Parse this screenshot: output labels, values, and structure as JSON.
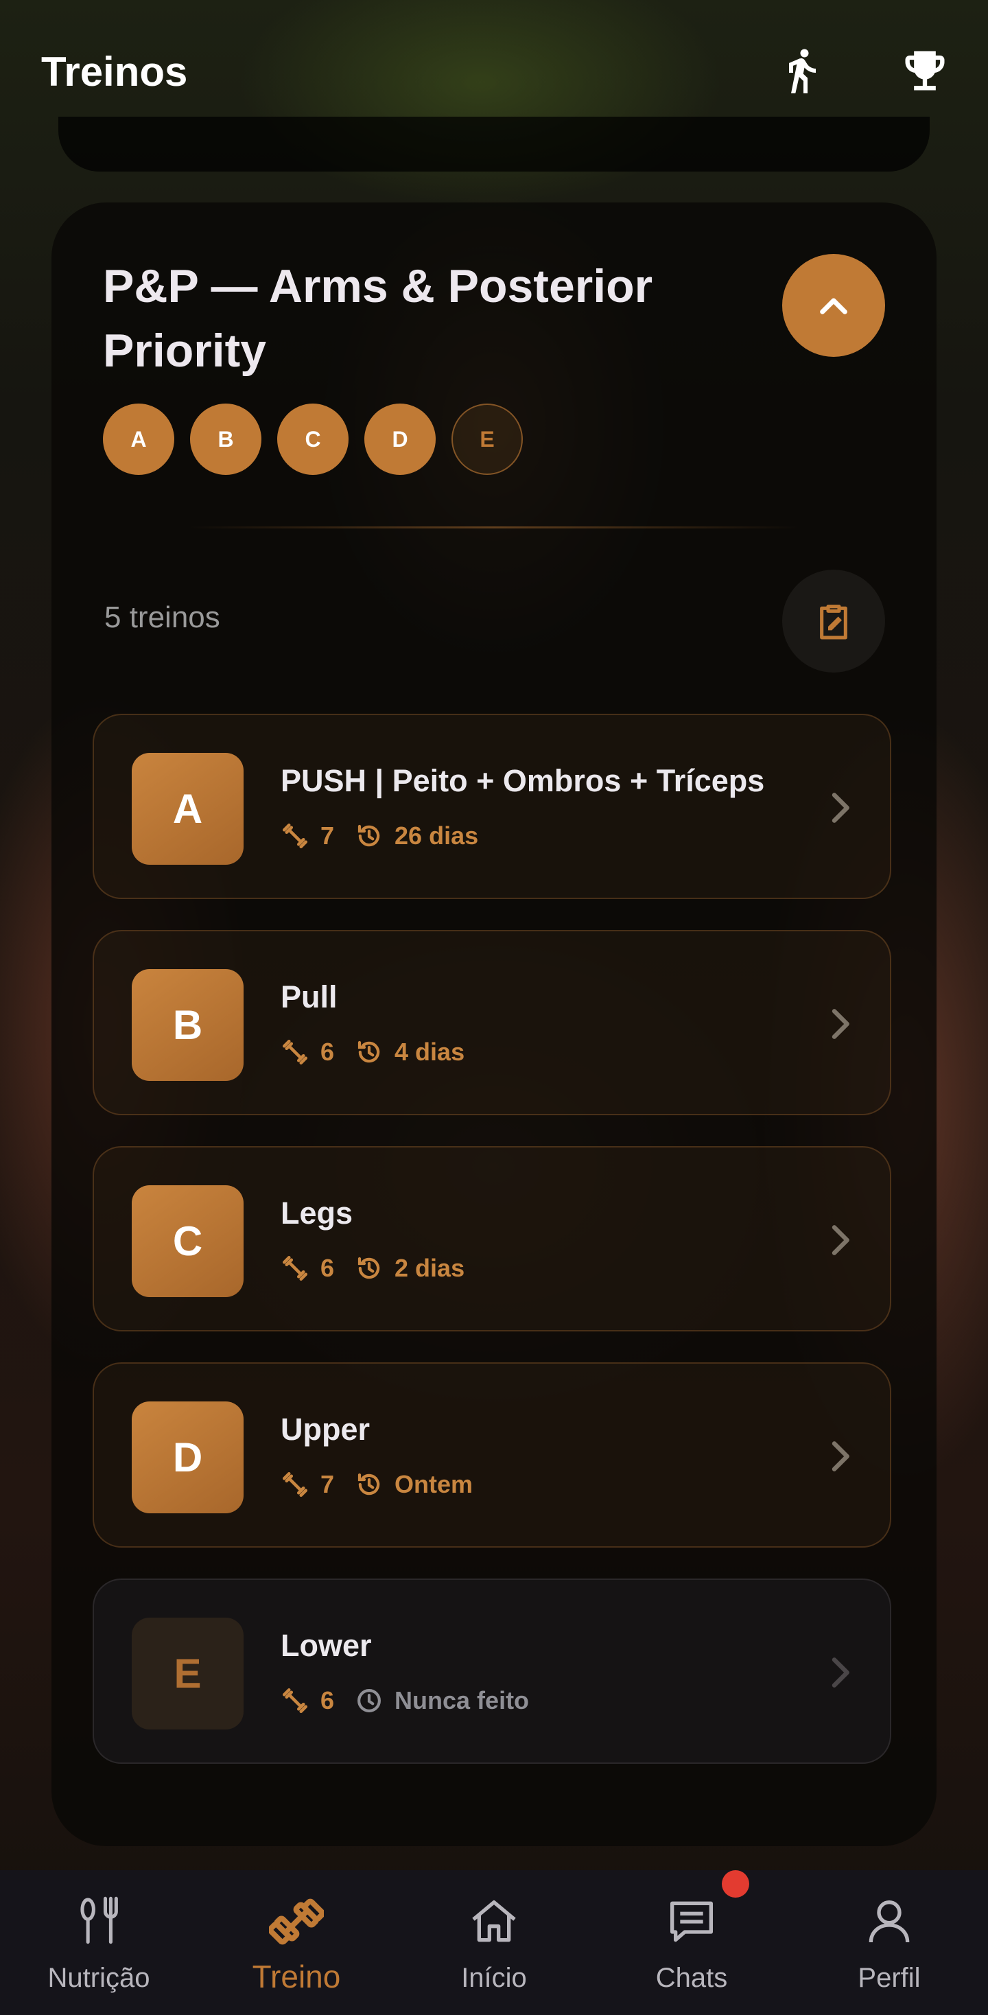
{
  "header": {
    "title": "Treinos",
    "run_icon": "running-icon",
    "trophy_icon": "trophy-icon"
  },
  "plan": {
    "title": "P&P — Arms & Posterior Priority",
    "chips": [
      "A",
      "B",
      "C",
      "D",
      "E"
    ],
    "count_label": "5 treinos"
  },
  "workouts": [
    {
      "letter": "A",
      "name": "PUSH | Peito + Ombros + Tríceps",
      "exercises": "7",
      "last": "26 dias",
      "done": true
    },
    {
      "letter": "B",
      "name": "Pull",
      "exercises": "6",
      "last": "4 dias",
      "done": true
    },
    {
      "letter": "C",
      "name": "Legs",
      "exercises": "6",
      "last": "2 dias",
      "done": true
    },
    {
      "letter": "D",
      "name": "Upper",
      "exercises": "7",
      "last": "Ontem",
      "done": true
    },
    {
      "letter": "E",
      "name": "Lower",
      "exercises": "6",
      "last": "Nunca feito",
      "done": false
    }
  ],
  "nav": [
    {
      "label": "Nutrição",
      "icon": "utensils-icon"
    },
    {
      "label": "Treino",
      "icon": "dumbbell-icon",
      "active": true
    },
    {
      "label": "Início",
      "icon": "home-icon"
    },
    {
      "label": "Chats",
      "icon": "chat-icon"
    },
    {
      "label": "Perfil",
      "icon": "profile-icon"
    }
  ],
  "colors": {
    "accent": "#c07a35",
    "notification": "#e33b30",
    "nav_bg": "#15141a"
  }
}
